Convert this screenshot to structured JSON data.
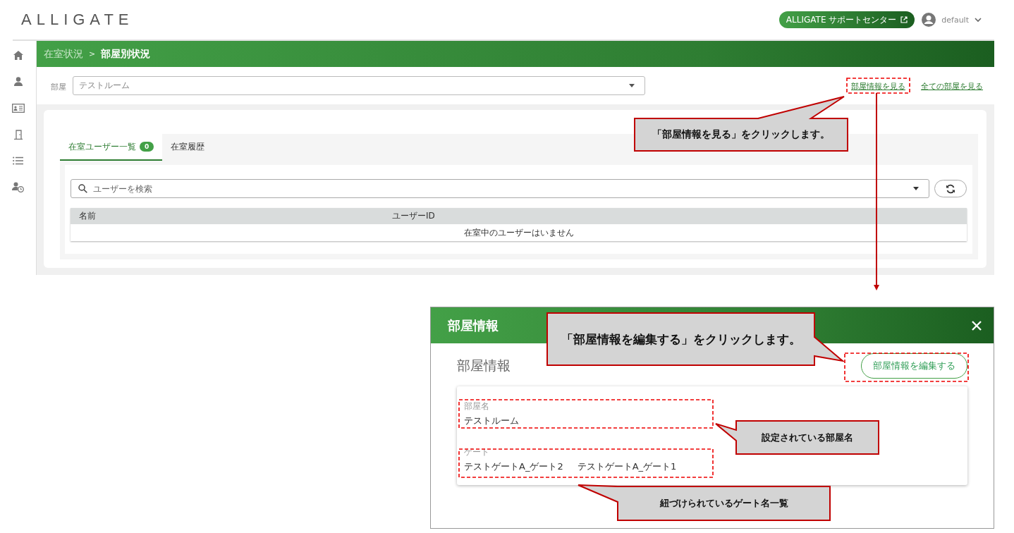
{
  "header": {
    "logo": "ALLIGATE",
    "support_button": "ALLIGATE サポートセンター",
    "user": "default"
  },
  "breadcrumb": {
    "separator": ">",
    "items": [
      {
        "label": "在室状況",
        "current": false
      },
      {
        "label": "部屋別状況",
        "current": true
      }
    ]
  },
  "room_filter": {
    "label": "部屋",
    "value": "テストルーム"
  },
  "links": [
    "部屋情報を見る",
    "全ての部屋を見る"
  ],
  "tabs": [
    {
      "label": "在室ユーザー一覧",
      "badge": "0",
      "selected": true
    },
    {
      "label": "在室履歴",
      "selected": false
    }
  ],
  "search": {
    "placeholder": "ユーザーを検索"
  },
  "table": {
    "columns": [
      "名前",
      "ユーザーID"
    ],
    "empty_message": "在室中のユーザーはいません"
  },
  "dialog": {
    "title": "部屋情報",
    "section_title": "部屋情報",
    "edit_button": "部屋情報を編集する",
    "fields": [
      {
        "label": "部屋名",
        "values": [
          "テストルーム"
        ]
      },
      {
        "label": "ゲート",
        "values": [
          "テストゲートA_ゲート2",
          "テストゲートA_ゲート1"
        ]
      }
    ]
  },
  "annotations": [
    {
      "text": "「部屋情報を見る」をクリックします。"
    },
    {
      "text": "「部屋情報を編集する」をクリックします。"
    },
    {
      "text": "設定されている部屋名"
    },
    {
      "text": "紐づけられているゲート名一覧"
    }
  ]
}
